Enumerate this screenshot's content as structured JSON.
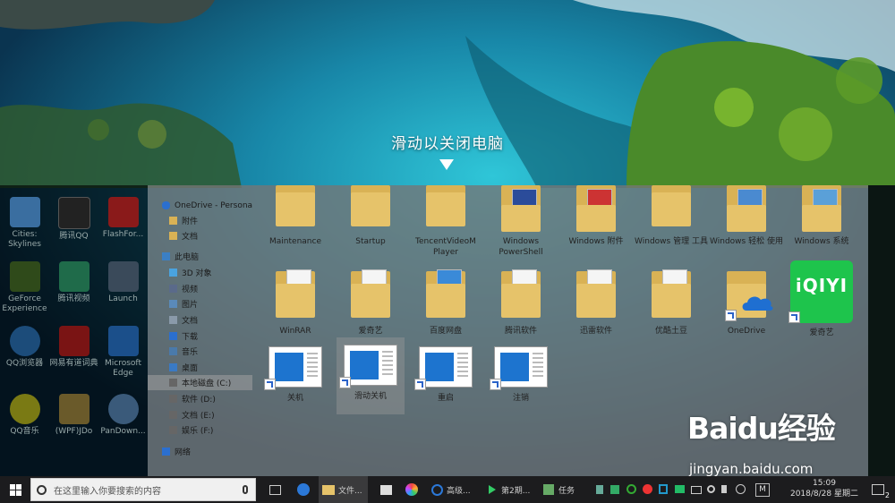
{
  "lock_hint": {
    "text": "滑动以关闭电脑"
  },
  "desktop_icons": [
    {
      "label": "Cities: Skylines",
      "icon": "city-icon"
    },
    {
      "label": "腾讯QQ",
      "icon": "qq-icon"
    },
    {
      "label": "FlashFor...",
      "icon": "flash-icon"
    },
    {
      "label": "GeForce Experience",
      "icon": "geforce-icon"
    },
    {
      "label": "腾讯视频",
      "icon": "video-icon"
    },
    {
      "label": "Launch",
      "icon": "launch-icon"
    },
    {
      "label": "QQ浏览器",
      "icon": "qq-browser-icon"
    },
    {
      "label": "网易有道词典",
      "icon": "youdao-icon"
    },
    {
      "label": "Microsoft Edge",
      "icon": "edge-icon"
    },
    {
      "label": "QQ音乐",
      "icon": "qq-music-icon"
    },
    {
      "label": "(WPF)JDo",
      "icon": "file-icon"
    },
    {
      "label": "PanDown...",
      "icon": "cloud-icon"
    }
  ],
  "nav": {
    "items": [
      {
        "label": "OneDrive - Persona",
        "icon": "cloud-icon"
      },
      {
        "label": "附件",
        "icon": "folder-icon"
      },
      {
        "label": "文档",
        "icon": "folder-icon"
      },
      {
        "label": "此电脑",
        "icon": "pc-icon"
      },
      {
        "label": "3D 对象",
        "icon": "cube-icon"
      },
      {
        "label": "视频",
        "icon": "video-icon"
      },
      {
        "label": "图片",
        "icon": "picture-icon"
      },
      {
        "label": "文档",
        "icon": "document-icon"
      },
      {
        "label": "下载",
        "icon": "download-icon"
      },
      {
        "label": "音乐",
        "icon": "music-icon"
      },
      {
        "label": "桌面",
        "icon": "desktop-icon"
      },
      {
        "label": "本地磁盘 (C:)",
        "icon": "drive-icon"
      },
      {
        "label": "软件 (D:)",
        "icon": "drive-icon"
      },
      {
        "label": "文档 (E:)",
        "icon": "drive-icon"
      },
      {
        "label": "娱乐 (F:)",
        "icon": "drive-icon"
      },
      {
        "label": "网络",
        "icon": "network-icon"
      }
    ]
  },
  "content": {
    "row1": [
      "Maintenance",
      "Startup",
      "TencentVideoM Player",
      "Windows PowerShell",
      "Windows 附件",
      "Windows 管理 工具",
      "Windows 轻松 使用",
      "Windows 系统"
    ],
    "row2": [
      "WinRAR",
      "爱奇艺",
      "百度网盘",
      "腾讯软件",
      "迅雷软件",
      "优酷土豆",
      "OneDrive",
      "爱奇艺"
    ],
    "row3": [
      "关机",
      "滑动关机",
      "重启",
      "注销"
    ],
    "iqiyi_logo": "iQIYI"
  },
  "taskbar": {
    "search_placeholder": "在这里输入你要搜索的内容",
    "apps": [
      {
        "label": "文件...",
        "icon": "explorer-icon"
      },
      {
        "label": "高级...",
        "icon": "browser-icon"
      },
      {
        "label": "第2期...",
        "icon": "media-icon"
      },
      {
        "label": "任务",
        "icon": "task-icon"
      }
    ],
    "input_method": "M",
    "time": "15:09",
    "date": "2018/8/28 星期二",
    "notification_count": "2"
  },
  "watermark": {
    "brand": "Baidu经验",
    "url": "jingyan.baidu.com"
  },
  "colors": {
    "folder": "#e6c36a",
    "accent_blue": "#1d74cf",
    "taskbar": "#1c1c1e",
    "iqiyi": "#1ec44c"
  }
}
